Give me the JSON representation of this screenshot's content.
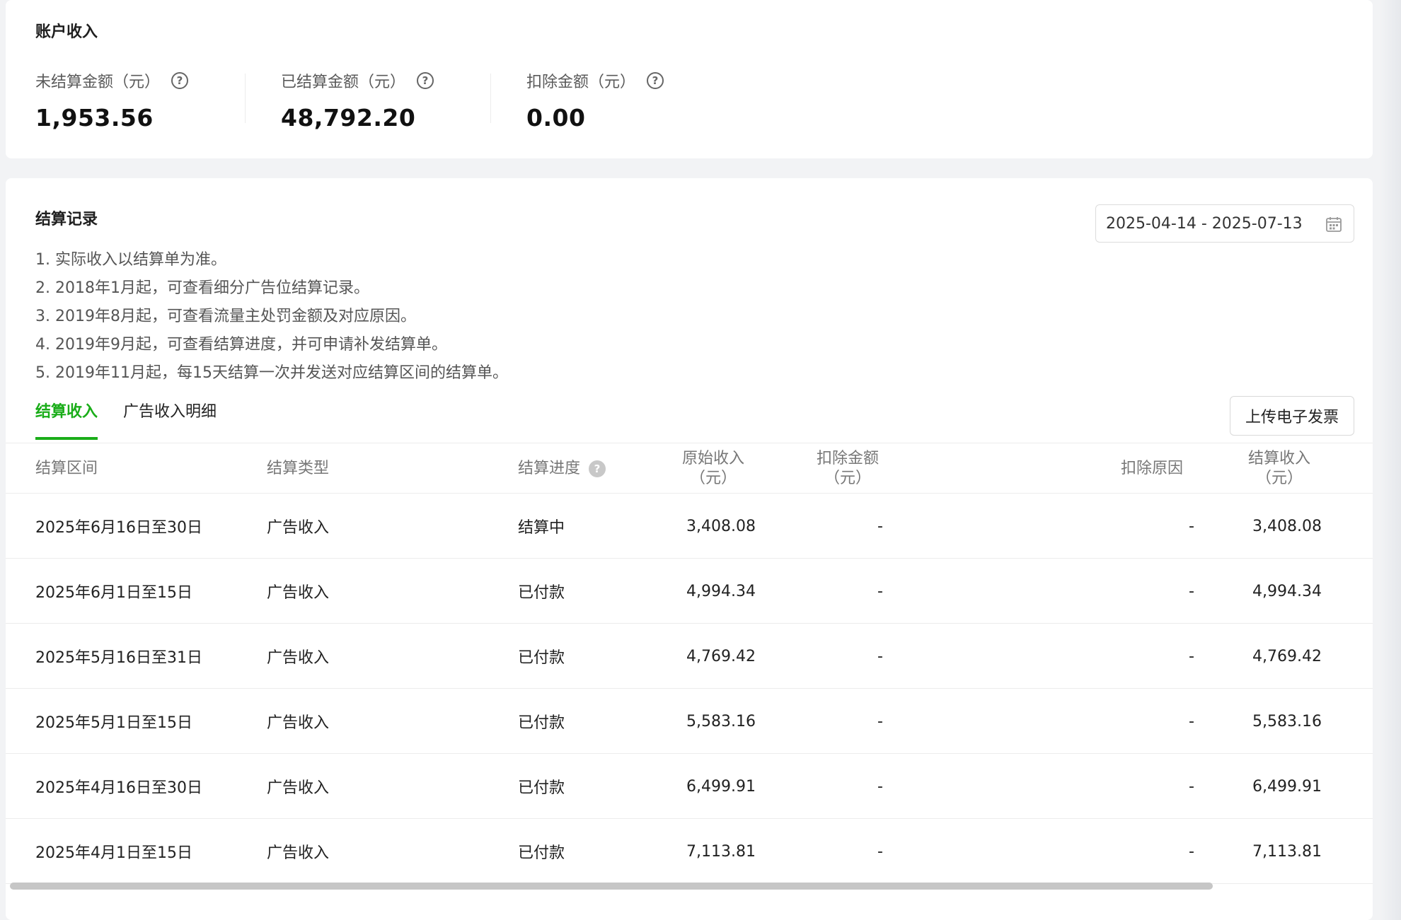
{
  "summary": {
    "title": "账户收入",
    "stats": [
      {
        "label": "未结算金额（元）",
        "value": "1,953.56"
      },
      {
        "label": "已结算金额（元）",
        "value": "48,792.20"
      },
      {
        "label": "扣除金额（元）",
        "value": "0.00"
      }
    ]
  },
  "records": {
    "title": "结算记录",
    "date_range": "2025-04-14 - 2025-07-13",
    "notes": [
      "1. 实际收入以结算单为准。",
      "2. 2018年1月起，可查看细分广告位结算记录。",
      "3. 2019年8月起，可查看流量主处罚金额及对应原因。",
      "4. 2019年9月起，可查看结算进度，并可申请补发结算单。",
      "5. 2019年11月起，每15天结算一次并发送对应结算区间的结算单。"
    ],
    "tabs": [
      {
        "label": "结算收入",
        "active": true
      },
      {
        "label": "广告收入明细",
        "active": false
      }
    ],
    "upload_button": "上传电子发票",
    "columns": {
      "period": "结算区间",
      "type": "结算类型",
      "progress": "结算进度",
      "original": "原始收入（元）",
      "deduct_amount": "扣除金额（元）",
      "deduct_reason": "扣除原因",
      "settled": "结算收入（元）"
    },
    "rows": [
      {
        "period": "2025年6月16日至30日",
        "type": "广告收入",
        "progress": "结算中",
        "original": "3,408.08",
        "deduct_amount": "-",
        "deduct_reason": "-",
        "settled": "3,408.08"
      },
      {
        "period": "2025年6月1日至15日",
        "type": "广告收入",
        "progress": "已付款",
        "original": "4,994.34",
        "deduct_amount": "-",
        "deduct_reason": "-",
        "settled": "4,994.34"
      },
      {
        "period": "2025年5月16日至31日",
        "type": "广告收入",
        "progress": "已付款",
        "original": "4,769.42",
        "deduct_amount": "-",
        "deduct_reason": "-",
        "settled": "4,769.42"
      },
      {
        "period": "2025年5月1日至15日",
        "type": "广告收入",
        "progress": "已付款",
        "original": "5,583.16",
        "deduct_amount": "-",
        "deduct_reason": "-",
        "settled": "5,583.16"
      },
      {
        "period": "2025年4月16日至30日",
        "type": "广告收入",
        "progress": "已付款",
        "original": "6,499.91",
        "deduct_amount": "-",
        "deduct_reason": "-",
        "settled": "6,499.91"
      },
      {
        "period": "2025年4月1日至15日",
        "type": "广告收入",
        "progress": "已付款",
        "original": "7,113.81",
        "deduct_amount": "-",
        "deduct_reason": "-",
        "settled": "7,113.81"
      }
    ]
  },
  "colors": {
    "accent": "#1aad19"
  }
}
